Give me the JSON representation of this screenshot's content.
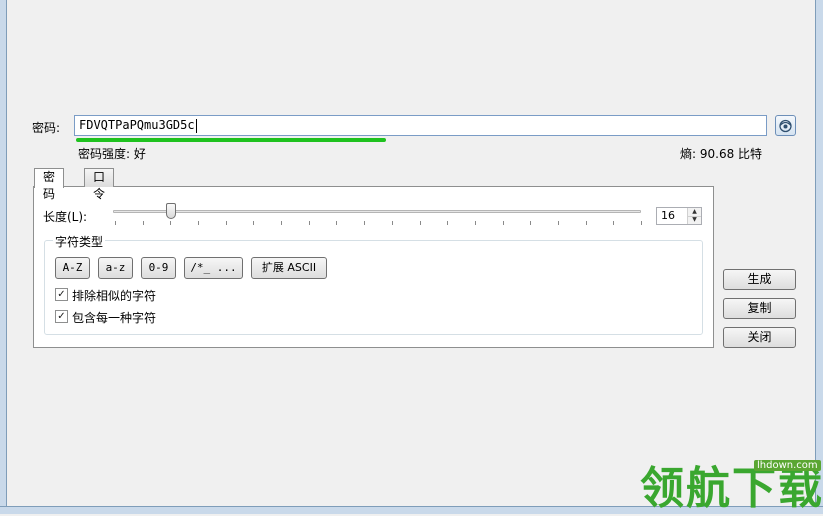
{
  "password": {
    "label": "密码:",
    "value": "FDVQTPaPQmu3GD5c",
    "strength_text": "密码强度: 好",
    "entropy_text": "熵: 90.68 比特",
    "strength_level": 0.5,
    "strength_color": "#1fc21f"
  },
  "tabs": [
    {
      "label": "密码",
      "active": true
    },
    {
      "label": "口令",
      "active": false
    }
  ],
  "length": {
    "label": "长度(L):",
    "value": "16",
    "slider_fraction": 0.11
  },
  "charset": {
    "title": "字符类型",
    "buttons": [
      {
        "label": "A-Z",
        "on": true
      },
      {
        "label": "a-z",
        "on": true
      },
      {
        "label": "0-9",
        "on": true
      },
      {
        "label": "/*_ ...",
        "on": false
      },
      {
        "label": "扩展 ASCII",
        "on": false
      }
    ],
    "options": [
      {
        "label": "排除相似的字符",
        "checked": true
      },
      {
        "label": "包含每一种字符",
        "checked": true
      }
    ]
  },
  "actions": {
    "generate": "生成",
    "copy": "复制",
    "close": "关闭"
  },
  "watermark": {
    "text": "领航下载",
    "url": "lhdown.com"
  },
  "icons": {
    "eye_button": "eye-icon",
    "check_mark": "✓",
    "spin_up": "▲",
    "spin_down": "▼"
  },
  "colors": {
    "accent": "#3c7fb1",
    "watermark": "#3aa72f"
  }
}
